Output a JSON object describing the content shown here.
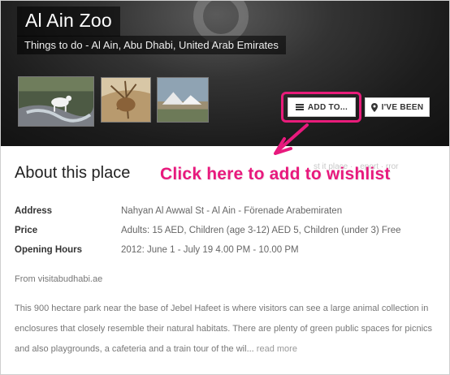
{
  "header": {
    "title": "Al Ain Zoo",
    "subtitle": "Things to do - Al Ain, Abu Dhabi, United Arab Emirates"
  },
  "photos": [
    {
      "icon": "photo-waterfall-goat"
    },
    {
      "icon": "photo-animal"
    },
    {
      "icon": "photo-tent-landscape"
    }
  ],
  "actions": {
    "add_label": "ADD TO...",
    "been_label": "I'VE BEEN"
  },
  "annotation": {
    "callout": "Click here to add to wishlist",
    "accent": "#e8197d"
  },
  "about": {
    "heading": "About this place",
    "faded_links": "st  it place  ·  ·  eport  ·  rror"
  },
  "details": [
    {
      "label": "Address",
      "value": "Nahyan Al Awwal St - Al Ain - Förenade Arabemiraten"
    },
    {
      "label": "Price",
      "value": "Adults: 15 AED, Children (age 3-12) AED 5, Children (under 3) Free"
    },
    {
      "label": "Opening Hours",
      "value": "2012: June 1 - July 19 4.00 PM - 10.00 PM"
    }
  ],
  "source": "From visitabudhabi.ae",
  "description": {
    "text": "This 900 hectare park near the base of Jebel Hafeet is where visitors can see a large animal collection in enclosures that closely resemble their natural habitats. There are plenty of green public spaces for picnics and also playgrounds, a cafeteria and a train tour of the wil...",
    "more": "read more"
  }
}
